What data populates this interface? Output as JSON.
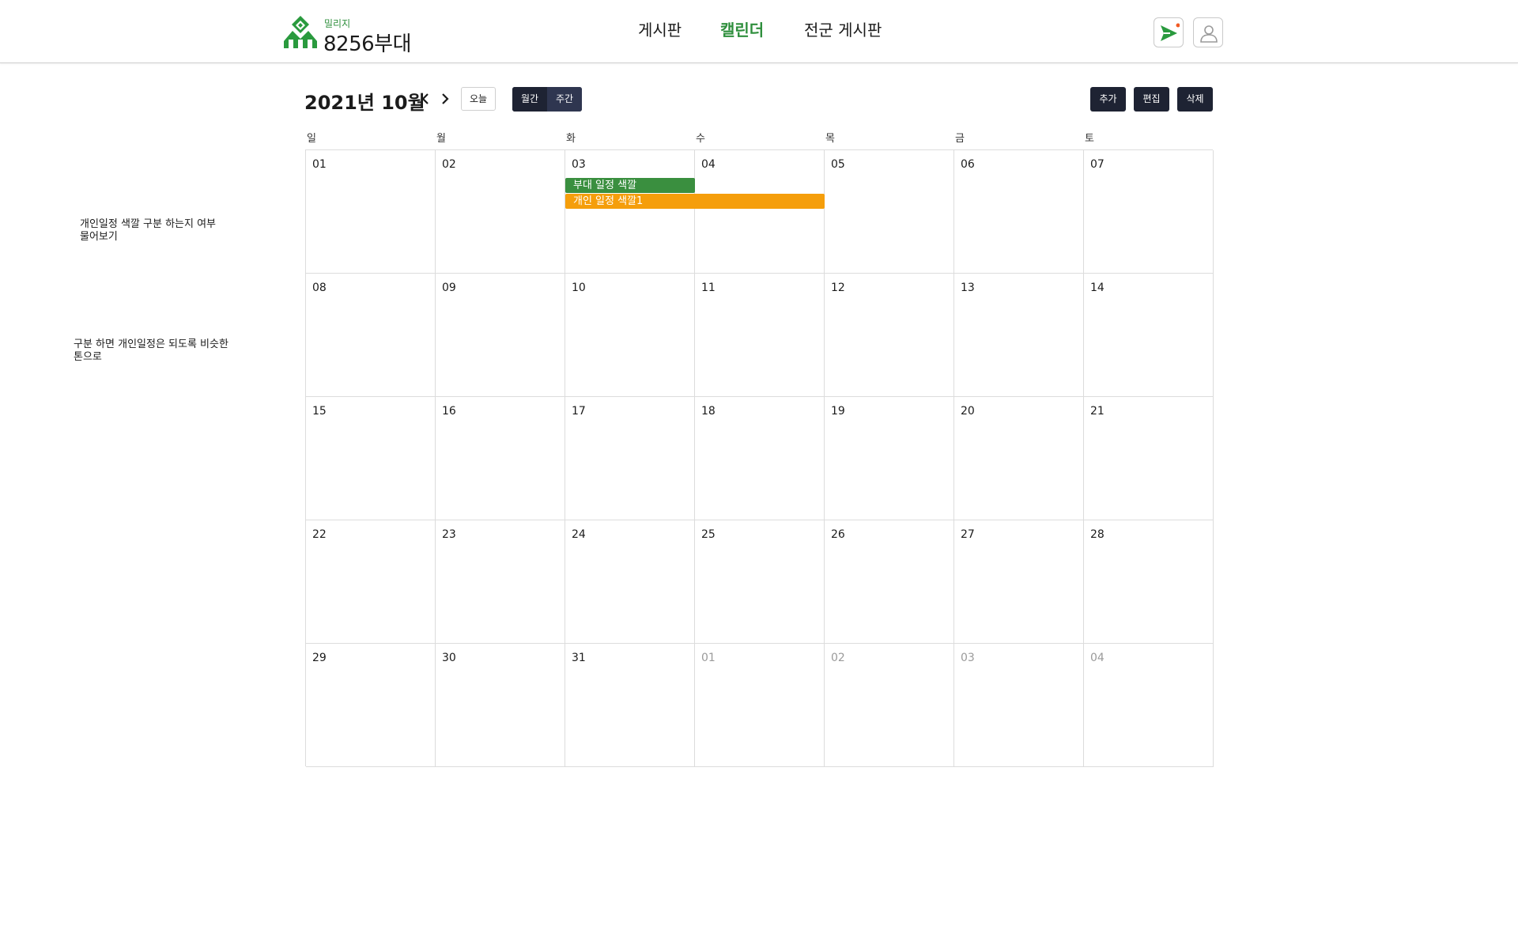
{
  "header": {
    "logo_sub": "밀리지",
    "logo_title": "8256부대",
    "nav": [
      {
        "label": "게시판",
        "active": false
      },
      {
        "label": "캘린더",
        "active": true
      },
      {
        "label": "전군 게시판",
        "active": false
      }
    ],
    "icons": [
      "send-icon",
      "user-icon"
    ],
    "accent_color": "#2f8f3d"
  },
  "toolbar": {
    "month_title": "2021년 10월",
    "today_label": "오늘",
    "view_month_label": "월간",
    "view_week_label": "주간",
    "add_label": "추가",
    "edit_label": "편집",
    "delete_label": "삭제"
  },
  "calendar": {
    "weekdays": [
      "일",
      "월",
      "화",
      "수",
      "목",
      "금",
      "토"
    ],
    "weeks": [
      [
        "01",
        "02",
        "03",
        "04",
        "05",
        "06",
        "07"
      ],
      [
        "08",
        "09",
        "10",
        "11",
        "12",
        "13",
        "14"
      ],
      [
        "15",
        "16",
        "17",
        "18",
        "19",
        "20",
        "21"
      ],
      [
        "22",
        "23",
        "24",
        "25",
        "26",
        "27",
        "28"
      ],
      [
        "29",
        "30",
        "31",
        "01",
        "02",
        "03",
        "04"
      ]
    ],
    "next_month_days": [
      "01",
      "02",
      "03",
      "04"
    ],
    "events": [
      {
        "label": "부대 일정 색깔",
        "start_date": "03",
        "end_date": "03",
        "color": "#3a8f3f"
      },
      {
        "label": "개인 일정 색깔1",
        "start_date": "03",
        "end_date": "04",
        "color": "#f59e0b"
      }
    ]
  },
  "notes": [
    "개인일정 색깔 구분 하는지 여부\n물어보기",
    "구분 하면 개인일정은 되도록 비슷한\n톤으로"
  ]
}
